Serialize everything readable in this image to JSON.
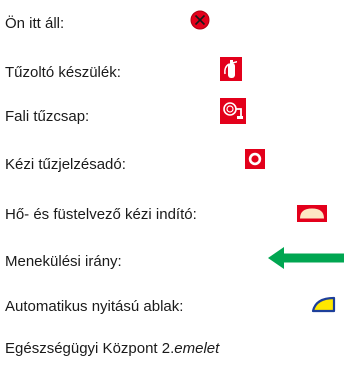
{
  "legend": {
    "items": [
      {
        "label": "Ön itt áll:",
        "icon": "you-are-here-icon"
      },
      {
        "label": "Tűzoltó készülék:",
        "icon": "fire-extinguisher-icon"
      },
      {
        "label": "Fali tűzcsap:",
        "icon": "fire-hose-reel-icon"
      },
      {
        "label": "Kézi tűzjelzésadó:",
        "icon": "manual-fire-alarm-icon"
      },
      {
        "label": "Hő- és füstelvező kézi indító:",
        "icon": "smoke-vent-trigger-icon"
      },
      {
        "label": "Menekülési irány:",
        "icon": "escape-route-arrow-icon"
      },
      {
        "label": "Automatikus nyitású ablak:",
        "icon": "automatic-window-icon"
      }
    ]
  },
  "footer": {
    "building": "Egészségügyi Központ 2.",
    "floor": "emelet"
  },
  "colors": {
    "safety_red": "#e3001b",
    "escape_green": "#00a651",
    "window_yellow": "#ffe800",
    "window_blue": "#1d3f9a",
    "vent_beige": "#fde7c4"
  }
}
